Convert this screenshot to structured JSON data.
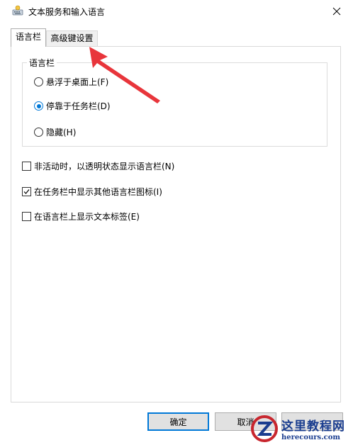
{
  "window": {
    "title": "文本服务和输入语言"
  },
  "tabs": [
    {
      "label": "语言栏",
      "active": true
    },
    {
      "label": "高级键设置",
      "active": false
    }
  ],
  "language_bar_group": {
    "label": "语言栏",
    "options": [
      {
        "label": "悬浮于桌面上(F)",
        "selected": false
      },
      {
        "label": "停靠于任务栏(D)",
        "selected": true
      },
      {
        "label": "隐藏(H)",
        "selected": false
      }
    ]
  },
  "checkboxes": [
    {
      "label": "非活动时，以透明状态显示语言栏(N)",
      "checked": false
    },
    {
      "label": "在任务栏中显示其他语言栏图标(I)",
      "checked": true
    },
    {
      "label": "在语言栏上显示文本标签(E)",
      "checked": false
    }
  ],
  "buttons": {
    "ok": "确定",
    "cancel": "取消"
  },
  "annotation": {
    "arrow_color": "#e8353b"
  },
  "watermark": {
    "cn": "这里教程网",
    "url": "herecours.com"
  },
  "colors": {
    "accent": "#0078d7"
  }
}
